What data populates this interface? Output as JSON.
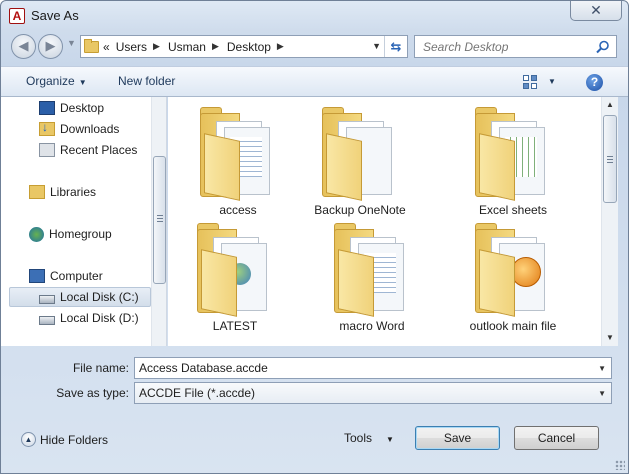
{
  "window": {
    "title": "Save As",
    "app_icon_letter": "A",
    "close_symbol": "✕"
  },
  "address": {
    "overflow": "«",
    "crumbs": [
      "Users",
      "Usman",
      "Desktop"
    ],
    "separator": "▶"
  },
  "search": {
    "placeholder": "Search Desktop"
  },
  "toolbar": {
    "organize_label": "Organize",
    "new_folder_label": "New folder",
    "help_symbol": "?"
  },
  "navigation": {
    "items": [
      {
        "label": "Desktop",
        "icon": "desktop-icon"
      },
      {
        "label": "Downloads",
        "icon": "downloads-folder-icon"
      },
      {
        "label": "Recent Places",
        "icon": "recent-places-icon"
      },
      {
        "label": "Libraries",
        "icon": "libraries-icon"
      },
      {
        "label": "Homegroup",
        "icon": "homegroup-icon"
      },
      {
        "label": "Computer",
        "icon": "computer-icon"
      },
      {
        "label": "Local Disk (C:)",
        "icon": "disk-icon",
        "selected": true
      },
      {
        "label": "Local Disk (D:)",
        "icon": "disk-icon"
      }
    ]
  },
  "files": {
    "items": [
      {
        "label": "access",
        "icon": "folder-icon"
      },
      {
        "label": "Backup OneNote",
        "icon": "folder-icon"
      },
      {
        "label": "Excel sheets",
        "icon": "folder-icon"
      },
      {
        "label": "LATEST",
        "icon": "folder-icon"
      },
      {
        "label": "macro Word",
        "icon": "folder-icon"
      },
      {
        "label": "outlook main file",
        "icon": "folder-icon"
      }
    ]
  },
  "form": {
    "file_name_label": "File name:",
    "file_name_value": "Access Database.accde",
    "save_type_label": "Save as type:",
    "save_type_value": "ACCDE File (*.accde)"
  },
  "footer": {
    "hide_folders_label": "Hide Folders",
    "tools_label": "Tools",
    "save_label": "Save",
    "cancel_label": "Cancel"
  }
}
